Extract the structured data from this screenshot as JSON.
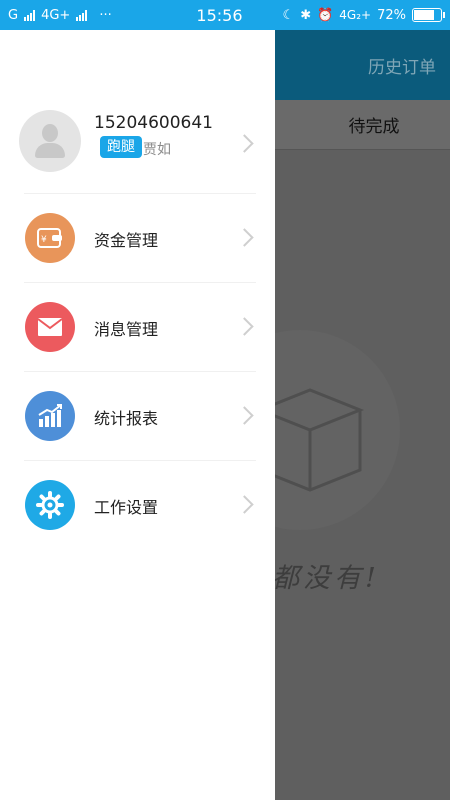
{
  "status_bar": {
    "carrier1": "G",
    "carrier2": "4G+",
    "dots": "···",
    "time": "15:56",
    "network_right": "4G₂+",
    "battery": "72%",
    "battery_level": 0.72
  },
  "background": {
    "header_link": "历史订单",
    "active_tab": "待完成",
    "empty_text": "都没有!"
  },
  "drawer": {
    "profile": {
      "phone": "15204600641",
      "role_tag": "跑腿",
      "name": "贾如"
    },
    "menu": [
      {
        "label": "资金管理",
        "icon": "wallet-icon",
        "color": "#e8955a"
      },
      {
        "label": "消息管理",
        "icon": "mail-icon",
        "color": "#ec5a5e"
      },
      {
        "label": "统计报表",
        "icon": "chart-icon",
        "color": "#4e8fd8"
      },
      {
        "label": "工作设置",
        "icon": "gear-icon",
        "color": "#1fa9e6"
      }
    ]
  }
}
